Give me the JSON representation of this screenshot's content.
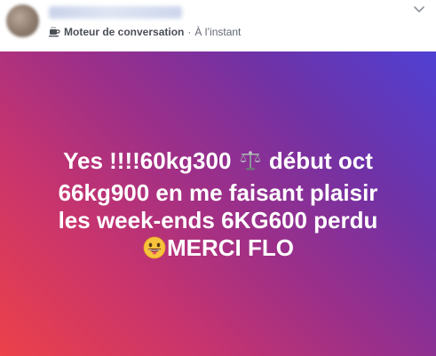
{
  "header": {
    "app_name": "Moteur de conversation",
    "separator": "·",
    "time": "À l’instant",
    "icons": {
      "app": "coffee-cup-icon",
      "menu": "chevron-down-icon"
    }
  },
  "post": {
    "lines": [
      "Yes !!!!60kg300",
      "début oct",
      "66kg900 en me faisant plaisir",
      "les week-ends 6KG600 perdu",
      "MERCI FLO"
    ],
    "icons": {
      "scale": "balance-scale-icon",
      "face": "grinning-face-tongue-icon"
    },
    "colors": {
      "gradient_start": "#ec4149",
      "gradient_mid": "#9b2f8a",
      "gradient_end": "#4f40d4",
      "text": "#ffffff"
    }
  }
}
